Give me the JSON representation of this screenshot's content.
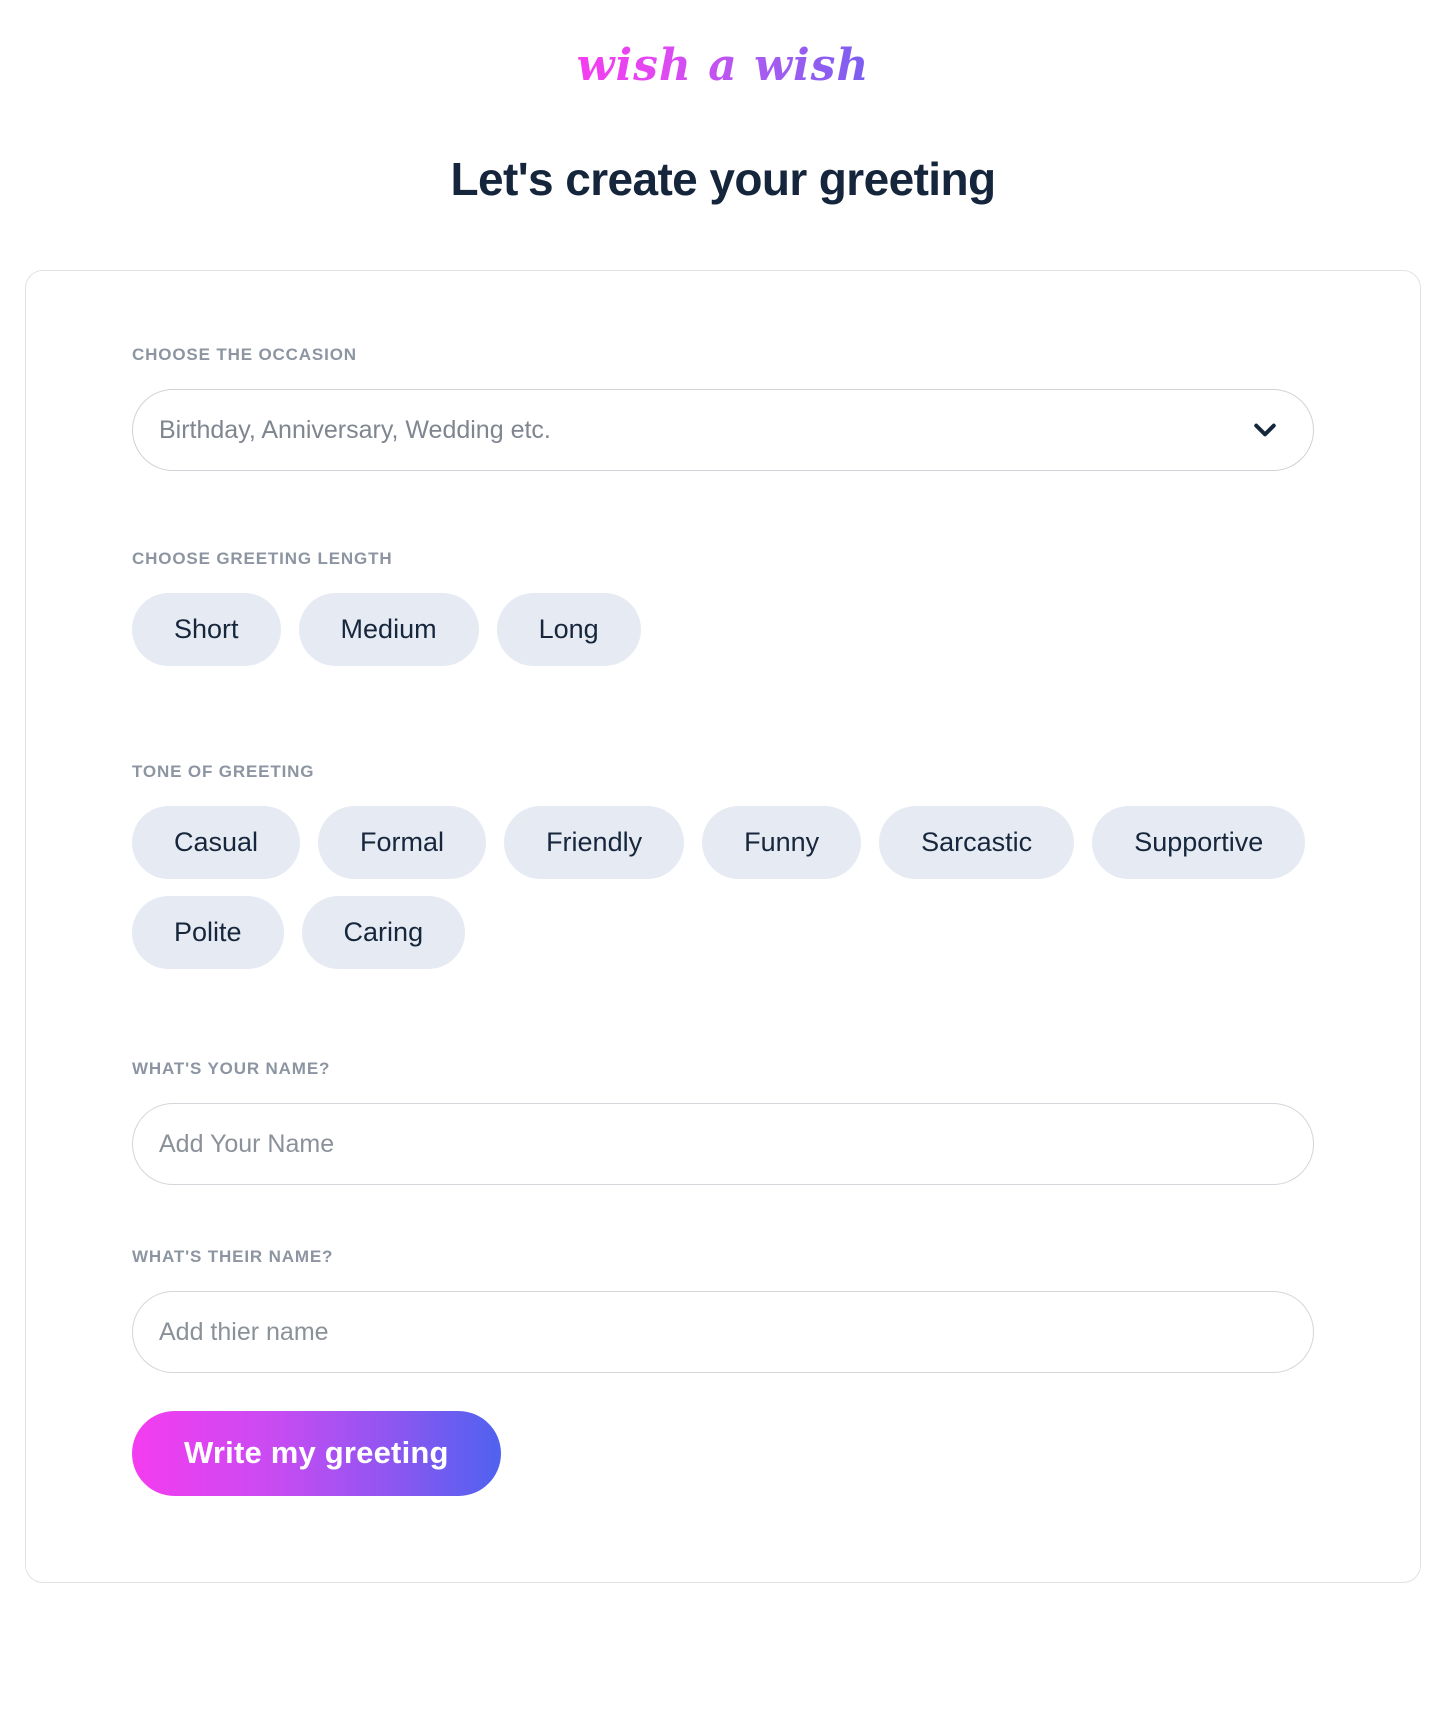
{
  "brand": {
    "name": "wish a wish",
    "gradient_from": "#f43cf0",
    "gradient_to": "#7b5ef0"
  },
  "header": {
    "title": "Let's create your greeting",
    "title_color": "#15253b"
  },
  "form": {
    "occasion": {
      "label": "CHOOSE THE OCCASION",
      "selected_value": "Birthday, Anniversary, Wedding etc.",
      "chevron": "chevron-down-icon"
    },
    "length": {
      "label": "CHOOSE GREETING LENGTH",
      "options": [
        "Short",
        "Medium",
        "Long"
      ]
    },
    "tone": {
      "label": "TONE OF GREETING",
      "options": [
        "Casual",
        "Formal",
        "Friendly",
        "Funny",
        "Sarcastic",
        "Supportive",
        "Polite",
        "Caring"
      ]
    },
    "your_name": {
      "label": "WHAT'S YOUR NAME?",
      "value": "",
      "placeholder": "Add Your Name"
    },
    "their_name": {
      "label": "WHAT'S THEIR NAME?",
      "value": "",
      "placeholder": "Add thier name"
    },
    "submit": {
      "label": "Write my greeting",
      "gradient_from": "#f43cf0",
      "gradient_to": "#4f62ef"
    }
  },
  "theme": {
    "pill_background": "#e6eaf2",
    "pill_text": "#16263c",
    "label_color": "#8c95a1",
    "card_border": "#e0e2e6",
    "input_border": "#cfd2d6",
    "placeholder_color": "#8b9199",
    "page_background": "#ffffff"
  }
}
